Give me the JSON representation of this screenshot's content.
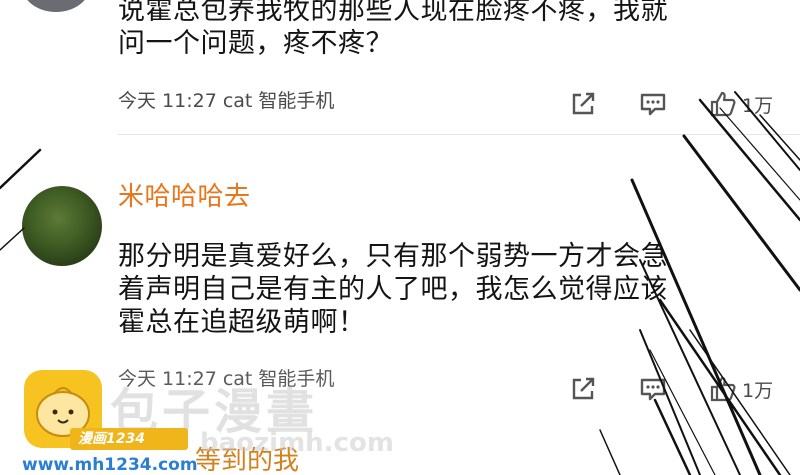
{
  "comments": [
    {
      "text_lines": [
        "说霍总包养我牧的那些人现在脸疼不疼，我就",
        "问一个问题，疼不疼？"
      ],
      "meta": "今天 11:27 cat 智能手机",
      "like_count": "1万"
    },
    {
      "username": "米哈哈哈去",
      "text_lines": [
        "那分明是真爱好么，只有那个弱势一方才会急",
        "着声明自己是有主的人了吧，我怎么觉得应该",
        "霍总在追超级萌啊！"
      ],
      "meta": "今天 11:27 cat 智能手机",
      "like_count": "1万"
    },
    {
      "username": "等到的我"
    }
  ],
  "watermark": {
    "title": "包子漫畫",
    "sub": "baozimh.com",
    "banner": "漫画1234",
    "url": "www.mh1234.com"
  },
  "colors": {
    "username": "#e8761c",
    "text": "#141414",
    "meta": "#4a4a4a",
    "watermark_logo": "#f7c320",
    "watermark_url": "#2a7fd4"
  },
  "icons": [
    "share-icon",
    "comment-icon",
    "like-icon"
  ]
}
